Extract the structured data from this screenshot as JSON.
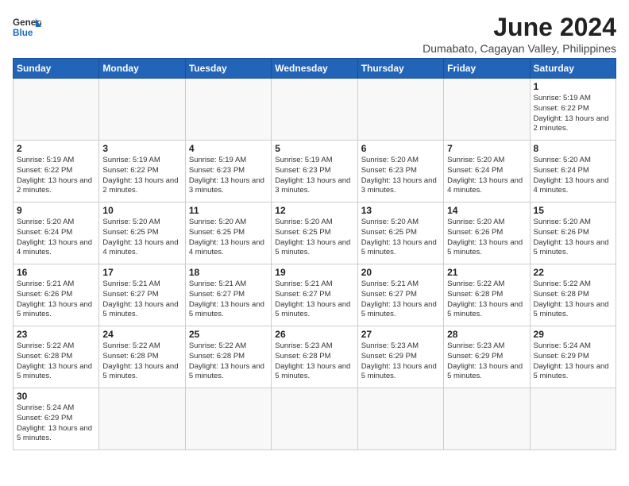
{
  "logo": {
    "line1": "General",
    "line2": "Blue"
  },
  "title": "June 2024",
  "subtitle": "Dumabato, Cagayan Valley, Philippines",
  "days_of_week": [
    "Sunday",
    "Monday",
    "Tuesday",
    "Wednesday",
    "Thursday",
    "Friday",
    "Saturday"
  ],
  "weeks": [
    [
      {
        "day": "",
        "info": ""
      },
      {
        "day": "",
        "info": ""
      },
      {
        "day": "",
        "info": ""
      },
      {
        "day": "",
        "info": ""
      },
      {
        "day": "",
        "info": ""
      },
      {
        "day": "",
        "info": ""
      },
      {
        "day": "1",
        "info": "Sunrise: 5:19 AM\nSunset: 6:22 PM\nDaylight: 13 hours and 2 minutes."
      }
    ],
    [
      {
        "day": "2",
        "info": "Sunrise: 5:19 AM\nSunset: 6:22 PM\nDaylight: 13 hours and 2 minutes."
      },
      {
        "day": "3",
        "info": "Sunrise: 5:19 AM\nSunset: 6:22 PM\nDaylight: 13 hours and 2 minutes."
      },
      {
        "day": "4",
        "info": "Sunrise: 5:19 AM\nSunset: 6:23 PM\nDaylight: 13 hours and 3 minutes."
      },
      {
        "day": "5",
        "info": "Sunrise: 5:19 AM\nSunset: 6:23 PM\nDaylight: 13 hours and 3 minutes."
      },
      {
        "day": "6",
        "info": "Sunrise: 5:20 AM\nSunset: 6:23 PM\nDaylight: 13 hours and 3 minutes."
      },
      {
        "day": "7",
        "info": "Sunrise: 5:20 AM\nSunset: 6:24 PM\nDaylight: 13 hours and 4 minutes."
      },
      {
        "day": "8",
        "info": "Sunrise: 5:20 AM\nSunset: 6:24 PM\nDaylight: 13 hours and 4 minutes."
      }
    ],
    [
      {
        "day": "9",
        "info": "Sunrise: 5:20 AM\nSunset: 6:24 PM\nDaylight: 13 hours and 4 minutes."
      },
      {
        "day": "10",
        "info": "Sunrise: 5:20 AM\nSunset: 6:25 PM\nDaylight: 13 hours and 4 minutes."
      },
      {
        "day": "11",
        "info": "Sunrise: 5:20 AM\nSunset: 6:25 PM\nDaylight: 13 hours and 4 minutes."
      },
      {
        "day": "12",
        "info": "Sunrise: 5:20 AM\nSunset: 6:25 PM\nDaylight: 13 hours and 5 minutes."
      },
      {
        "day": "13",
        "info": "Sunrise: 5:20 AM\nSunset: 6:25 PM\nDaylight: 13 hours and 5 minutes."
      },
      {
        "day": "14",
        "info": "Sunrise: 5:20 AM\nSunset: 6:26 PM\nDaylight: 13 hours and 5 minutes."
      },
      {
        "day": "15",
        "info": "Sunrise: 5:20 AM\nSunset: 6:26 PM\nDaylight: 13 hours and 5 minutes."
      }
    ],
    [
      {
        "day": "16",
        "info": "Sunrise: 5:21 AM\nSunset: 6:26 PM\nDaylight: 13 hours and 5 minutes."
      },
      {
        "day": "17",
        "info": "Sunrise: 5:21 AM\nSunset: 6:27 PM\nDaylight: 13 hours and 5 minutes."
      },
      {
        "day": "18",
        "info": "Sunrise: 5:21 AM\nSunset: 6:27 PM\nDaylight: 13 hours and 5 minutes."
      },
      {
        "day": "19",
        "info": "Sunrise: 5:21 AM\nSunset: 6:27 PM\nDaylight: 13 hours and 5 minutes."
      },
      {
        "day": "20",
        "info": "Sunrise: 5:21 AM\nSunset: 6:27 PM\nDaylight: 13 hours and 5 minutes."
      },
      {
        "day": "21",
        "info": "Sunrise: 5:22 AM\nSunset: 6:28 PM\nDaylight: 13 hours and 5 minutes."
      },
      {
        "day": "22",
        "info": "Sunrise: 5:22 AM\nSunset: 6:28 PM\nDaylight: 13 hours and 5 minutes."
      }
    ],
    [
      {
        "day": "23",
        "info": "Sunrise: 5:22 AM\nSunset: 6:28 PM\nDaylight: 13 hours and 5 minutes."
      },
      {
        "day": "24",
        "info": "Sunrise: 5:22 AM\nSunset: 6:28 PM\nDaylight: 13 hours and 5 minutes."
      },
      {
        "day": "25",
        "info": "Sunrise: 5:22 AM\nSunset: 6:28 PM\nDaylight: 13 hours and 5 minutes."
      },
      {
        "day": "26",
        "info": "Sunrise: 5:23 AM\nSunset: 6:28 PM\nDaylight: 13 hours and 5 minutes."
      },
      {
        "day": "27",
        "info": "Sunrise: 5:23 AM\nSunset: 6:29 PM\nDaylight: 13 hours and 5 minutes."
      },
      {
        "day": "28",
        "info": "Sunrise: 5:23 AM\nSunset: 6:29 PM\nDaylight: 13 hours and 5 minutes."
      },
      {
        "day": "29",
        "info": "Sunrise: 5:24 AM\nSunset: 6:29 PM\nDaylight: 13 hours and 5 minutes."
      }
    ],
    [
      {
        "day": "30",
        "info": "Sunrise: 5:24 AM\nSunset: 6:29 PM\nDaylight: 13 hours and 5 minutes."
      },
      {
        "day": "",
        "info": ""
      },
      {
        "day": "",
        "info": ""
      },
      {
        "day": "",
        "info": ""
      },
      {
        "day": "",
        "info": ""
      },
      {
        "day": "",
        "info": ""
      },
      {
        "day": "",
        "info": ""
      }
    ]
  ]
}
